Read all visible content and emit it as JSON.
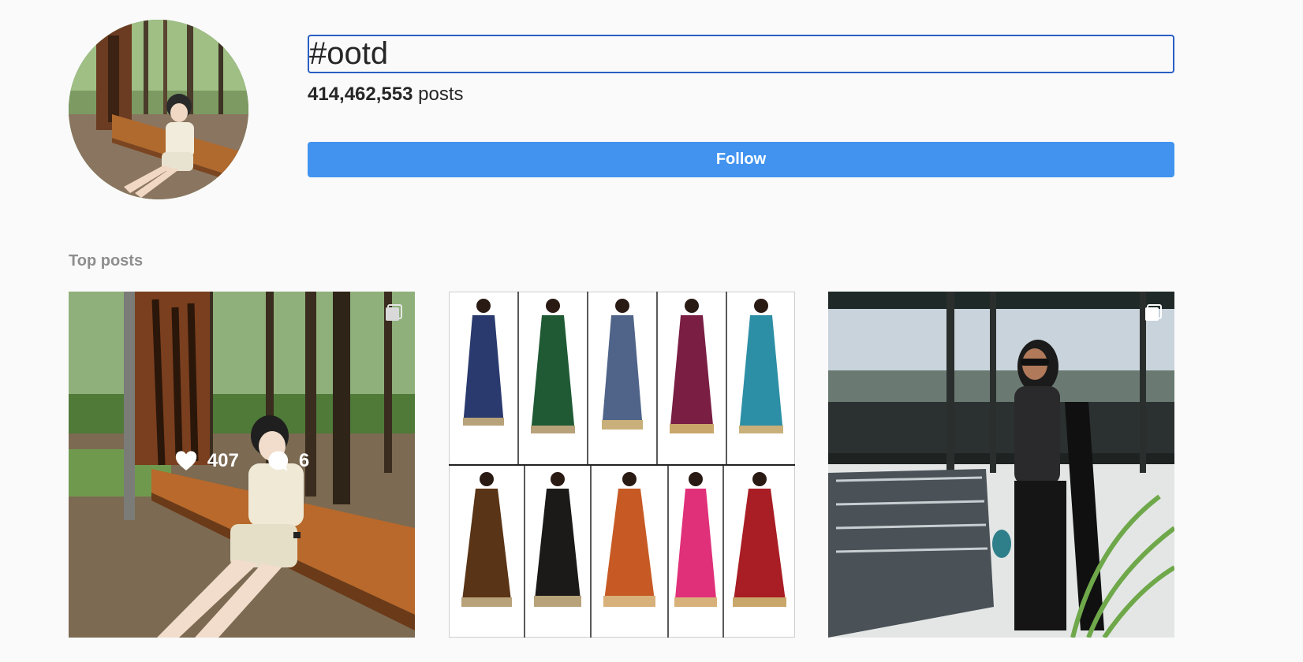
{
  "hashtag": {
    "title": "#ootd",
    "post_count": "414,462,553",
    "post_count_suffix": " posts",
    "follow_label": "Follow"
  },
  "top_posts": {
    "title": "Top posts",
    "posts": [
      {
        "likes": "407",
        "comments": "6",
        "multi_image": true,
        "subject": "woman seated on wooden bench under trees"
      },
      {
        "multi_image": false,
        "subject": "grid of models in ten printed kurta dresses"
      },
      {
        "multi_image": true,
        "subject": "woman in black outfit with sunglasses on a rooftop terrace"
      }
    ]
  },
  "colors": {
    "background": "#fafafa",
    "follow_button": "#4193ef",
    "input_border": "#2a5ec4",
    "section_title": "#8e8e8e"
  },
  "icons": [
    "heart-icon",
    "comment-icon",
    "multiple-images-icon"
  ]
}
